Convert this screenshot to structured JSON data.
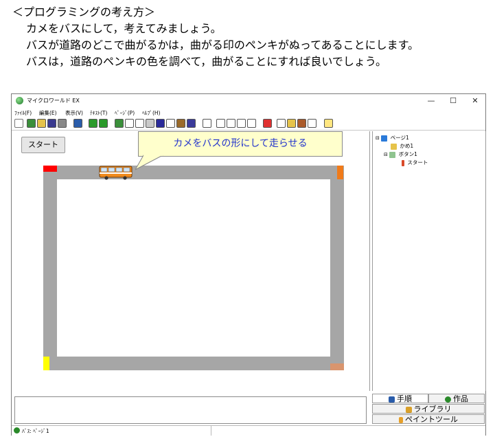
{
  "intro": {
    "heading": "＜プログラミングの考え方＞",
    "line1": "カメをバスにして，考えてみましょう。",
    "line2": "バスが道路のどこで曲がるかは，曲がる印のペンキがぬってあることにします。",
    "line3": "バスは，道路のペンキの色を調べて，曲がることにすれば良いでしょう。"
  },
  "window": {
    "title": "マイクロワールド EX",
    "controls": {
      "minimize": "—",
      "maximize": "☐",
      "close": "✕"
    }
  },
  "menu": [
    "ﾌｧｲﾙ(F)",
    "編集(E)",
    "表示(V)",
    "ﾃｷｽﾄ(T)",
    "ﾍﾟｰｼﾞ(P)",
    "ﾍﾙﾌﾟ(H)"
  ],
  "canvas": {
    "start_button": "スタート",
    "callout": "カメをバスの形にして走らせる"
  },
  "colors": {
    "road": "#a6a6a6",
    "top_left_mark": "#ff0000",
    "top_right_mark": "#f07b1a",
    "bottom_left_mark": "#ffff00",
    "bottom_right_mark": "#d9956e",
    "bus_body": "#f08a1c"
  },
  "tree": {
    "page": "ページ1",
    "turtle": "かめ1",
    "button": "ボタン1",
    "button_child": "スタート"
  },
  "tabs": {
    "steps": "手順",
    "works": "作品",
    "library": "ライブラリ",
    "paint": "ペイントツール"
  },
  "status": {
    "text": "ﾊﾞｽ: ﾍﾟｰｼﾞ1"
  },
  "icons": [
    "app-icon",
    "folder-icon",
    "save-icon",
    "print-icon",
    "arrow-left-icon",
    "arrow-right-icon",
    "turtle-icon",
    "text-icon",
    "eye-icon",
    "music-icon",
    "pointer-icon",
    "zoom-icon",
    "stop-icon",
    "help-icon"
  ]
}
